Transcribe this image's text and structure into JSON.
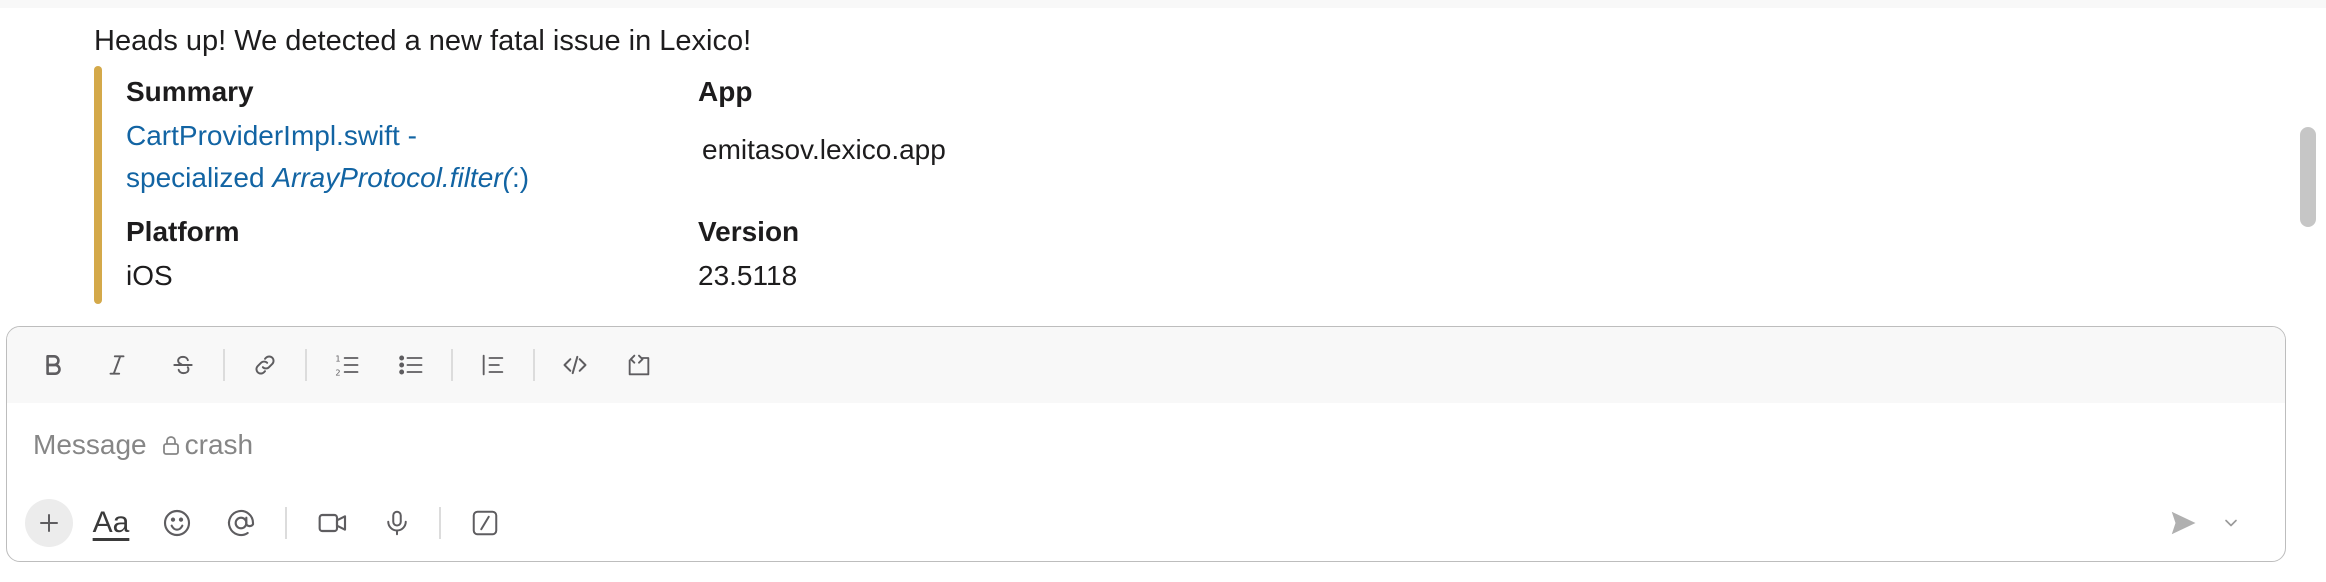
{
  "message": {
    "text": "Heads up! We detected a new fatal issue in Lexico!"
  },
  "attachment": {
    "accent_color": "#d4a94a",
    "summary_label": "Summary",
    "summary_link_line1": "CartProviderImpl.swift -",
    "summary_link_line2_prefix": "specialized ",
    "summary_link_line2_italic": "ArrayProtocol.filter(",
    "summary_link_line2_suffix": ":)",
    "app_label": "App",
    "app_value": "emitasov.lexico.app",
    "platform_label": "Platform",
    "platform_value": "iOS",
    "version_label": "Version",
    "version_value": "23.5118"
  },
  "composer": {
    "placeholder_prefix": "Message",
    "channel": "crash",
    "toolbar": {
      "bold_icon": "bold-icon",
      "italic_icon": "italic-icon",
      "strike_icon": "strikethrough-icon",
      "link_icon": "link-icon",
      "ordered_list_icon": "ordered-list-icon",
      "bullet_list_icon": "bullet-list-icon",
      "blockquote_icon": "blockquote-icon",
      "code_icon": "code-icon",
      "code_block_icon": "code-block-icon"
    },
    "bottom": {
      "plus_icon": "plus-icon",
      "format_label": "Aa",
      "emoji_icon": "emoji-icon",
      "mention_icon": "at-mention-icon",
      "video_icon": "video-icon",
      "mic_icon": "microphone-icon",
      "slash_icon": "slash-command-icon",
      "send_icon": "send-icon",
      "send_options_icon": "chevron-down-icon"
    }
  }
}
